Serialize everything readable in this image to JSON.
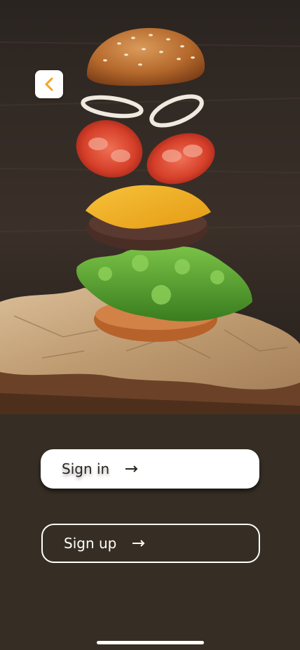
{
  "hero": {
    "image_description_icon": "burger-photo",
    "colors": {
      "background_dark": "#2b2520",
      "bun": "#c0793a",
      "tomato": "#d9452c",
      "cheese": "#f2b320",
      "patty": "#4a2f28",
      "lettuce": "#4f9a2e",
      "paper": "#c8a882"
    }
  },
  "nav": {
    "back_icon": "chevron-left-icon",
    "accent": "#f4a51c"
  },
  "actions": {
    "sign_in_label": "Sign in",
    "sign_up_label": "Sign up",
    "arrow_icon": "arrow-right-icon"
  },
  "theme": {
    "screen_bg": "#362e24",
    "button_light": "#ffffff"
  }
}
